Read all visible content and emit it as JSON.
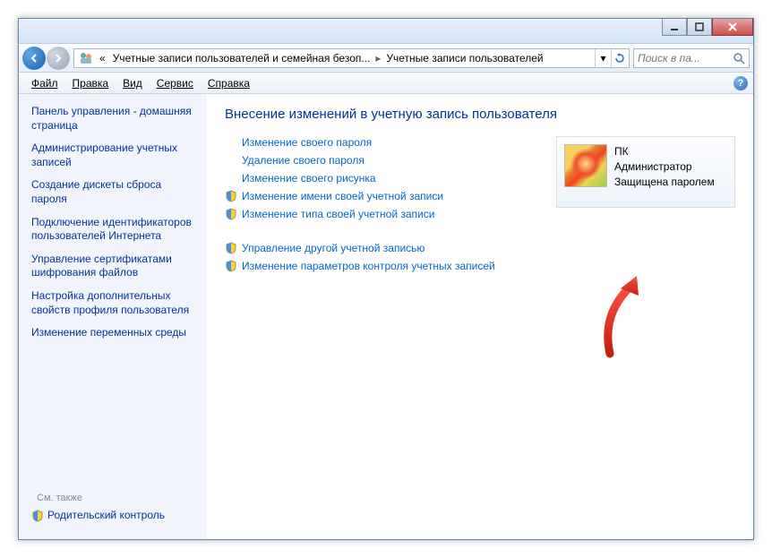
{
  "breadcrumb": {
    "prefix": "«",
    "part1": "Учетные записи пользователей и семейная безоп...",
    "part2": "Учетные записи пользователей"
  },
  "search": {
    "placeholder": "Поиск в па..."
  },
  "menu": {
    "file": "Файл",
    "edit": "Правка",
    "view": "Вид",
    "tools": "Сервис",
    "help": "Справка"
  },
  "sidebar": {
    "head": "Панель управления - домашняя страница",
    "links": [
      "Администрирование учетных записей",
      "Создание дискеты сброса пароля",
      "Подключение идентификаторов пользователей Интернета",
      "Управление сертификатами шифрования файлов",
      "Настройка дополнительных свойств профиля пользователя",
      "Изменение переменных среды"
    ],
    "see_also": "См. также",
    "parental": "Родительский контроль"
  },
  "main": {
    "title": "Внесение изменений в учетную запись пользователя",
    "actions": [
      {
        "shield": false,
        "label": "Изменение своего пароля"
      },
      {
        "shield": false,
        "label": "Удаление своего пароля"
      },
      {
        "shield": false,
        "label": "Изменение своего рисунка"
      },
      {
        "shield": true,
        "label": "Изменение имени своей учетной записи"
      },
      {
        "shield": true,
        "label": "Изменение типа своей учетной записи"
      }
    ],
    "actions2": [
      {
        "shield": true,
        "label": "Управление другой учетной записью"
      },
      {
        "shield": true,
        "label": "Изменение параметров контроля учетных записей"
      }
    ],
    "user": {
      "name": "ПК",
      "role": "Администратор",
      "status": "Защищена паролем"
    }
  }
}
